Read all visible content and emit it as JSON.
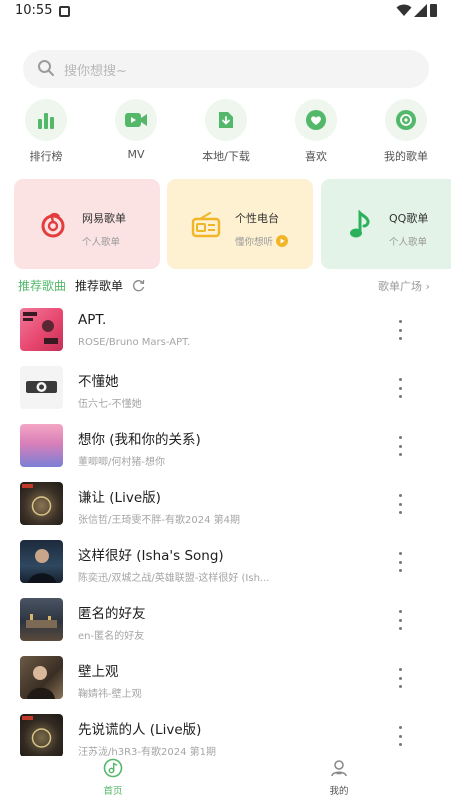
{
  "status_bar": {
    "time": "10:55"
  },
  "search": {
    "placeholder": "搜你想搜~"
  },
  "shortcuts": [
    {
      "label": "排行榜",
      "icon": "bar-chart-icon"
    },
    {
      "label": "MV",
      "icon": "video-icon"
    },
    {
      "label": "本地/下载",
      "icon": "download-icon"
    },
    {
      "label": "喜欢",
      "icon": "heart-icon"
    },
    {
      "label": "我的歌单",
      "icon": "disc-icon"
    }
  ],
  "source_cards": [
    {
      "title": "网易歌单",
      "subtitle": "个人歌单",
      "icon": "netease-music-icon",
      "bg": "#fbe3e4"
    },
    {
      "title": "个性电台",
      "subtitle": "懂你想听",
      "icon": "radio-icon",
      "bg": "#fdf1d2"
    },
    {
      "title": "QQ歌单",
      "subtitle": "个人歌单",
      "icon": "qq-music-icon",
      "bg": "#e3f3e8"
    }
  ],
  "tabs": {
    "recommended_songs": "推荐歌曲",
    "recommended_playlists": "推荐歌单",
    "playlist_plaza": "歌单广场"
  },
  "songs": [
    {
      "title": "APT.",
      "subtitle": "ROSÉ/Bruno Mars-APT."
    },
    {
      "title": "不懂她",
      "subtitle": "伍六七-不懂她"
    },
    {
      "title": "想你 (我和你的关系)",
      "subtitle": "董唧唧/何村猪-想你"
    },
    {
      "title": "谦让 (Live版)",
      "subtitle": "张信哲/王琦雯不胖-有歌2024 第4期"
    },
    {
      "title": "这样很好 (Isha's Song)",
      "subtitle": "陈奕迅/双城之战/英雄联盟-这样很好 (Ish..."
    },
    {
      "title": "匿名的好友",
      "subtitle": "en-匿名的好友"
    },
    {
      "title": "壁上观",
      "subtitle": "鞠婧祎-壁上观"
    },
    {
      "title": "先说谎的人 (Live版)",
      "subtitle": "汪苏泷/h3R3-有歌2024 第1期"
    }
  ],
  "bottom_nav": {
    "home": "首页",
    "mine": "我的"
  },
  "colors": {
    "accent": "#53b86a",
    "netease_red": "#e33d3d",
    "radio_yellow": "#f0b628",
    "qq_green": "#2db05c"
  }
}
